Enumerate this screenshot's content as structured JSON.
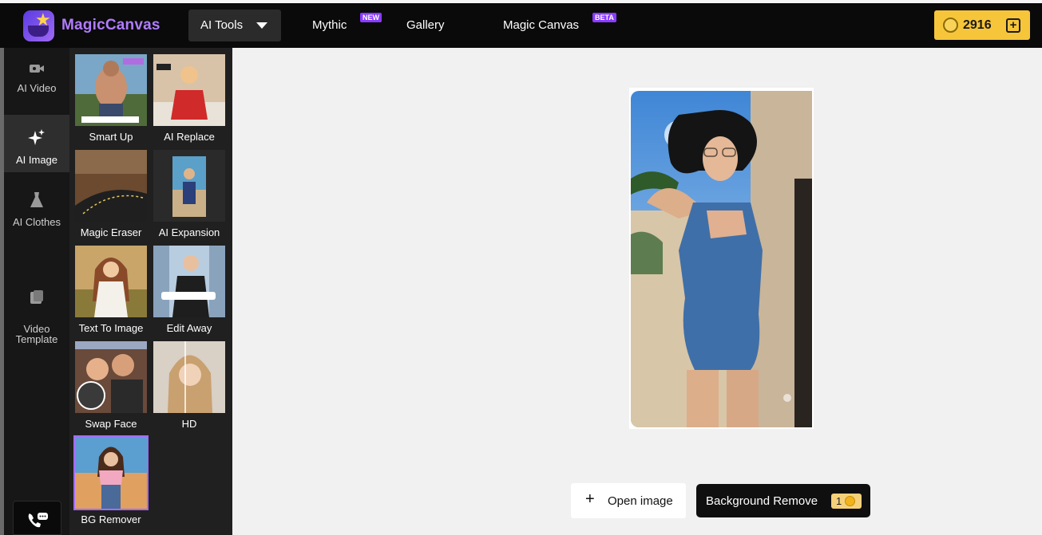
{
  "app": {
    "brand": "MagicCanvas"
  },
  "header": {
    "tools_label": "AI Tools",
    "nav": [
      {
        "label": "Mythic",
        "badge": "NEW"
      },
      {
        "label": "Gallery"
      },
      {
        "label": "Magic Canvas",
        "badge": "BETA"
      }
    ],
    "credits": "2916"
  },
  "sidebar": {
    "items": [
      {
        "label": "AI Video",
        "icon": "video-camera-icon"
      },
      {
        "label": "AI Image",
        "icon": "sparkle-icon",
        "active": true
      },
      {
        "label": "AI Clothes",
        "icon": "dress-icon"
      },
      {
        "label": "Video\nTemplate",
        "icon": "template-icon"
      }
    ]
  },
  "tools": [
    {
      "label": "Smart Up"
    },
    {
      "label": "AI Replace"
    },
    {
      "label": "Magic Eraser"
    },
    {
      "label": "AI Expansion"
    },
    {
      "label": "Text To Image"
    },
    {
      "label": "Edit Away"
    },
    {
      "label": "Swap Face"
    },
    {
      "label": "HD"
    },
    {
      "label": "BG Remover",
      "selected": true
    }
  ],
  "actions": {
    "open_image": "Open image",
    "background_remove": "Background Remove",
    "cost": "1"
  },
  "colors": {
    "accent": "#a46cff",
    "credits_bg": "#f6c53a",
    "topbar_bg": "#0a0a0a"
  }
}
